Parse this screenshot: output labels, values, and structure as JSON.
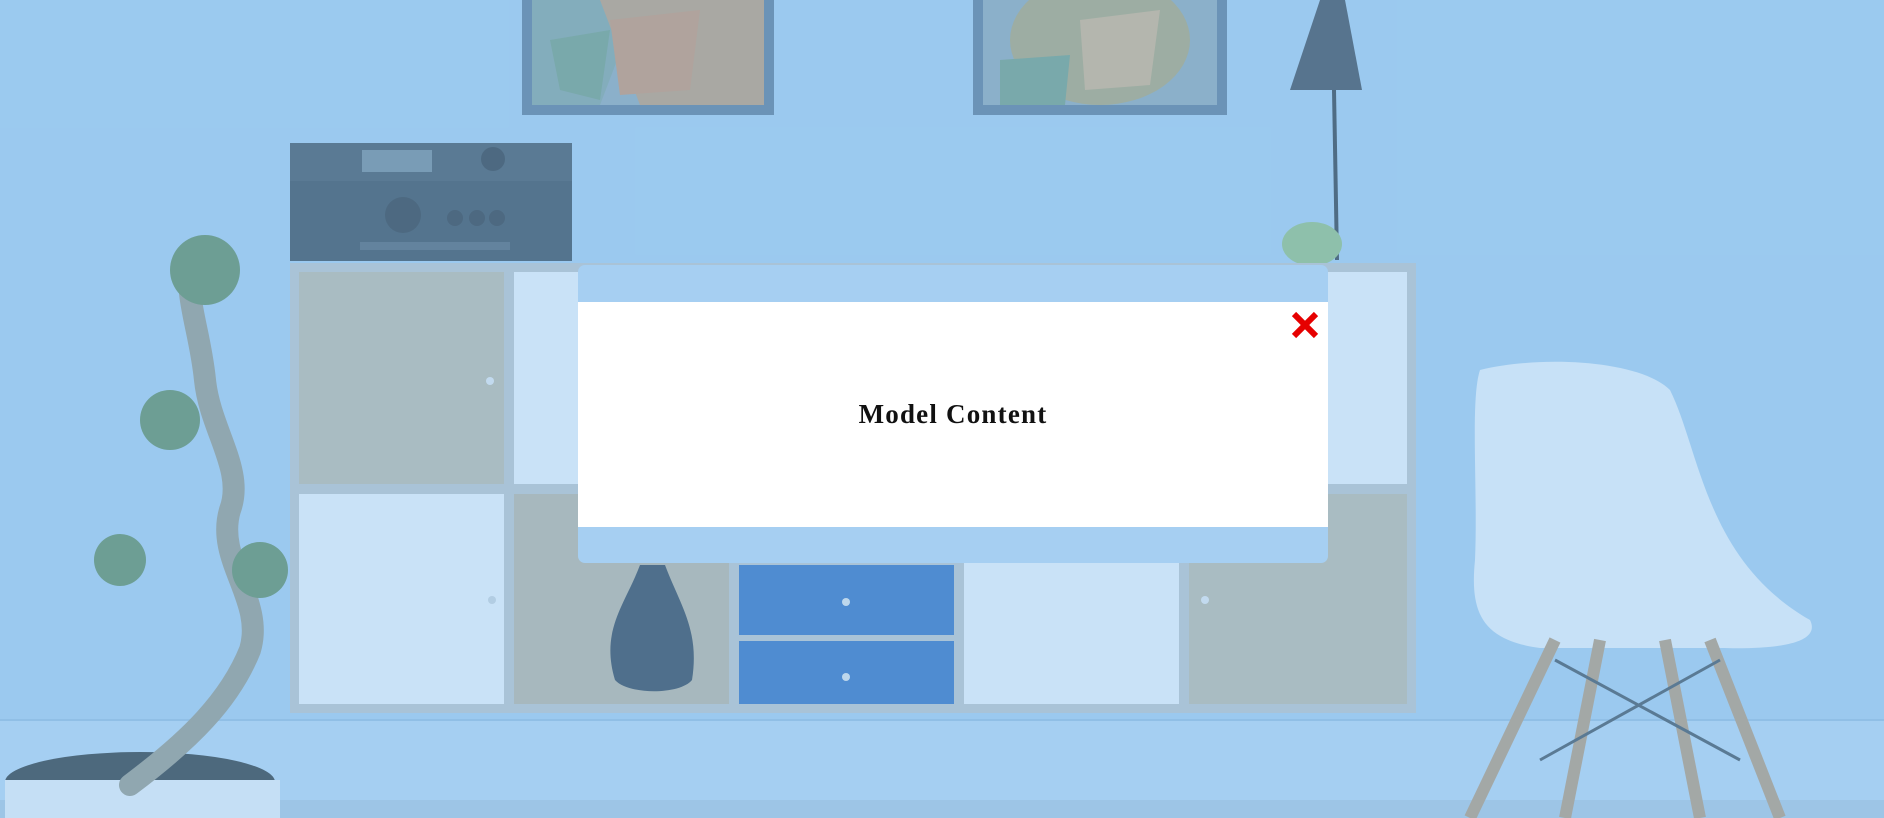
{
  "modal": {
    "title": "Model Content",
    "close_icon": "close-x-icon"
  },
  "colors": {
    "backdrop_tint": "#9ec9ea",
    "modal_frame": "#a6cff2",
    "modal_body": "#ffffff",
    "close_icon": "#e60000",
    "title_text": "#111111"
  }
}
